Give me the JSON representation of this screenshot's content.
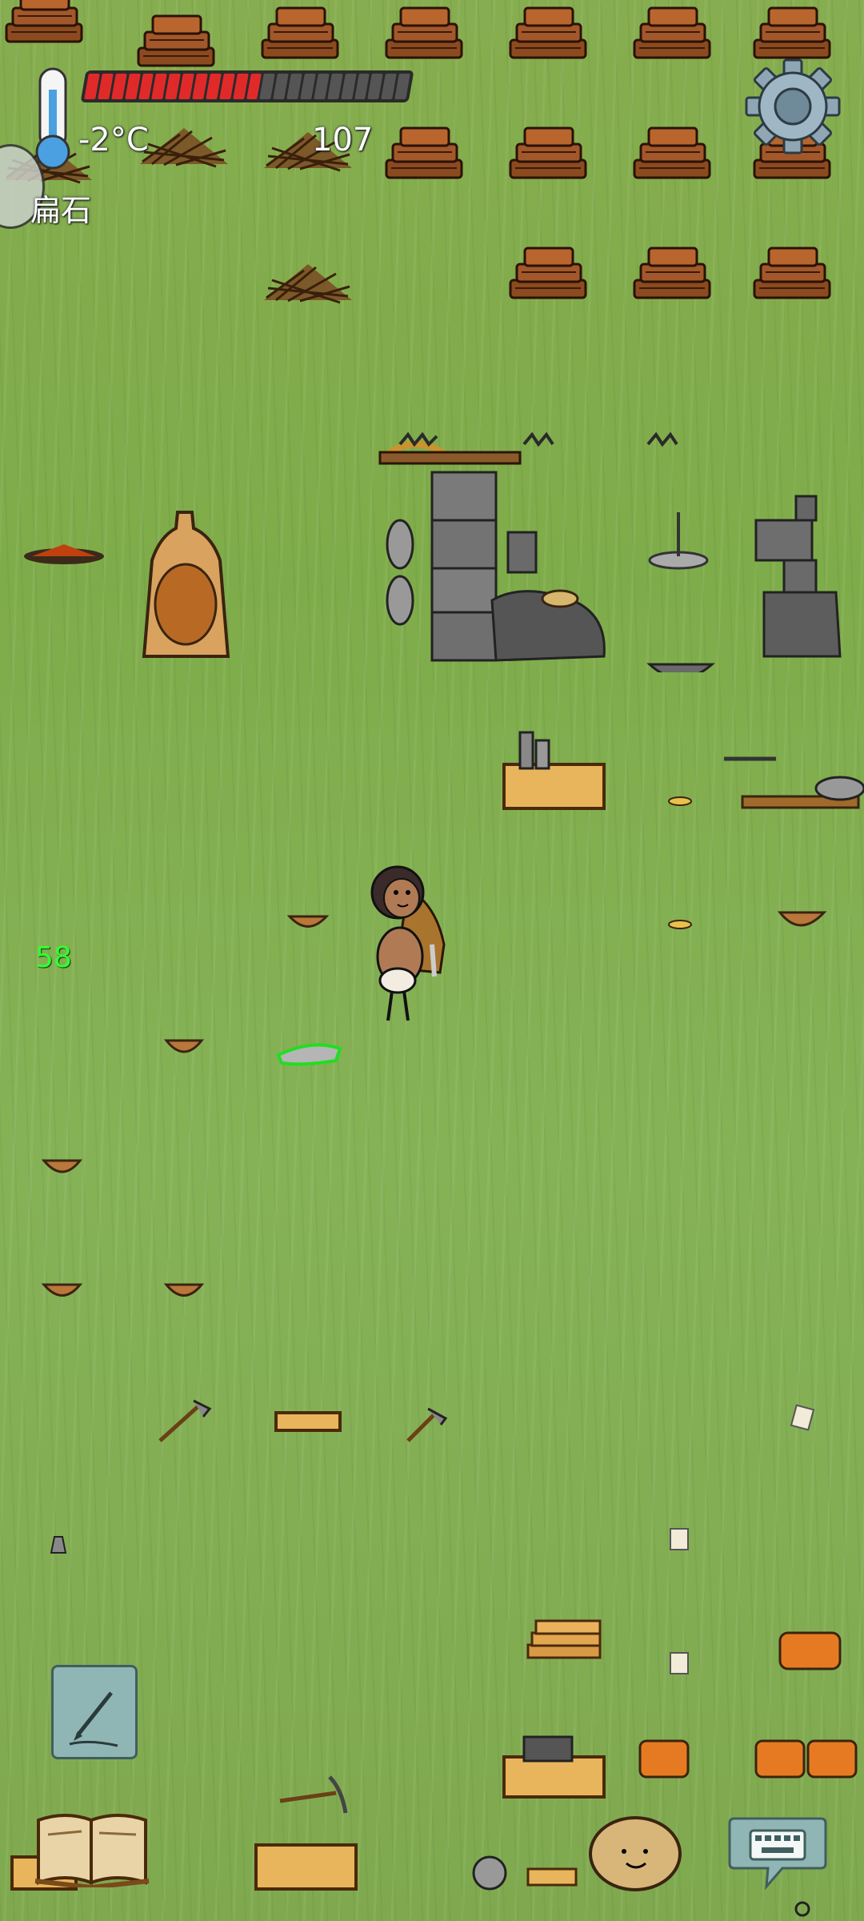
{
  "hud": {
    "temperature": "-2°C",
    "count": "107",
    "held_item": "扁石",
    "food_meter": {
      "filled": 13,
      "total": 24
    },
    "age_label": "58"
  },
  "colors": {
    "grass": "#7fac4a",
    "food_fill": "#e02a2a",
    "food_empty": "#555555",
    "age_label": "#33ff33",
    "selected_outline": "#22dd22"
  },
  "icons": {
    "thermometer": "thermometer-icon",
    "settings": "gear-icon",
    "note": "pencil-note-icon",
    "recipe_book": "book-icon",
    "emote": "smiley-face-icon",
    "chat": "keyboard-chat-icon"
  }
}
